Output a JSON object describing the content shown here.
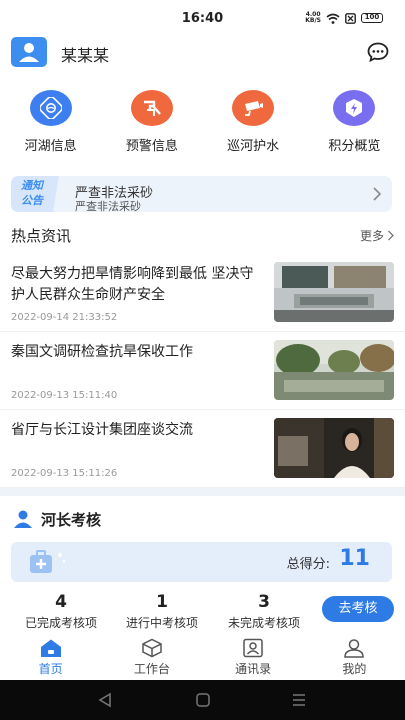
{
  "status_bar": {
    "time": "16:40",
    "net_speed_value": "4.00",
    "net_speed_unit": "KB/S",
    "battery": "100"
  },
  "header": {
    "user_name": "某某某",
    "avatar_icon": "user-avatar-icon",
    "chat_icon": "chat-bubble-icon"
  },
  "quick_menu": [
    {
      "label": "河湖信息",
      "icon": "river-lake-icon",
      "color": "#3d7ff0"
    },
    {
      "label": "预警信息",
      "icon": "warning-icon",
      "color": "#f0693e"
    },
    {
      "label": "巡河护水",
      "icon": "camera-patrol-icon",
      "color": "#f0693e"
    },
    {
      "label": "积分概览",
      "icon": "points-icon",
      "color": "#7a6ef0"
    }
  ],
  "notice": {
    "tag_line1": "通知",
    "tag_line2": "公告",
    "title": "严查非法采砂",
    "subtitle": "严查非法采砂"
  },
  "hot_news": {
    "title": "热点资讯",
    "more": "更多",
    "items": [
      {
        "title": "尽最大努力把旱情影响降到最低 坚决守护人民群众生命财产安全",
        "time": "2022-09-14 21:33:52"
      },
      {
        "title": "秦国文调研检查抗旱保收工作",
        "time": "2022-09-13 15:11:40"
      },
      {
        "title": "省厅与长江设计集团座谈交流",
        "time": "2022-09-13 15:11:26"
      }
    ]
  },
  "river_chief": {
    "title": "河长考核",
    "score_label": "总得分:",
    "score_value": "11",
    "stats": [
      {
        "value": "4",
        "label": "已完成考核项"
      },
      {
        "value": "1",
        "label": "进行中考核项"
      },
      {
        "value": "3",
        "label": "未完成考核项"
      }
    ],
    "action_label": "去考核"
  },
  "bottom_nav": [
    {
      "label": "首页",
      "icon": "home-icon",
      "active": true
    },
    {
      "label": "工作台",
      "icon": "workbench-icon",
      "active": false
    },
    {
      "label": "通讯录",
      "icon": "contacts-icon",
      "active": false
    },
    {
      "label": "我的",
      "icon": "profile-icon",
      "active": false
    }
  ],
  "colors": {
    "accent": "#2f7be6",
    "notice_bg": "#edf3fb",
    "score_bg": "#e4eefb"
  }
}
